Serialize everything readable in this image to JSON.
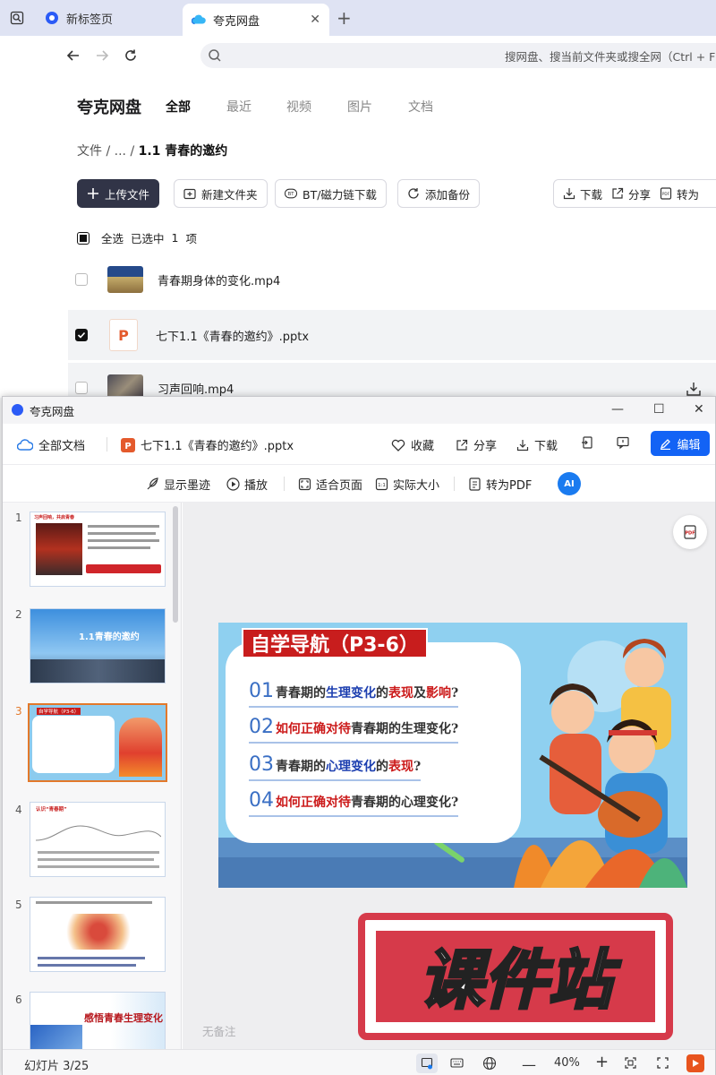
{
  "browser": {
    "tabs": [
      {
        "label": "新标签页",
        "active": false
      },
      {
        "label": "夸克网盘",
        "active": true
      }
    ],
    "address_placeholder": "搜网盘、搜当前文件夹或搜全网（Ctrl + F"
  },
  "drive": {
    "brand": "夸克网盘",
    "nav_tabs": [
      "全部",
      "最近",
      "视频",
      "图片",
      "文档"
    ],
    "breadcrumb": {
      "root": "文件",
      "sep1": "/",
      "ellipsis": "...",
      "sep2": "/",
      "current": "1.1 青春的邀约"
    },
    "actions": {
      "upload": "上传文件",
      "new_folder": "新建文件夹",
      "bt": "BT/磁力链下载",
      "backup": "添加备份",
      "download": "下载",
      "share": "分享",
      "convert": "转为"
    },
    "selection": {
      "select_all": "全选",
      "selected_prefix": "已选中",
      "selected_count": "1",
      "selected_suffix": "项"
    },
    "files": [
      {
        "name": "青春期身体的变化.mp4",
        "checked": false
      },
      {
        "name": "七下1.1《青春的邀约》.pptx",
        "checked": true
      },
      {
        "name": "习声回响.mp4",
        "checked": false
      }
    ]
  },
  "viewer": {
    "window_title": "夸克网盘",
    "breadcrumb_all": "全部文档",
    "file_name": "七下1.1《青春的邀约》.pptx",
    "toolbar": {
      "favorite": "收藏",
      "share": "分享",
      "download": "下载",
      "edit": "编辑"
    },
    "toolbar2": {
      "ink": "显示墨迹",
      "play": "播放",
      "fit_page": "适合页面",
      "actual_size": "实际大小",
      "to_pdf": "转为PDF",
      "ai": "AI"
    },
    "thumbnails": [
      {
        "num": "1",
        "caption": "习声回响，共启青春"
      },
      {
        "num": "2",
        "caption": "1.1青春的邀约"
      },
      {
        "num": "3",
        "caption": "自学导航（P3-6）"
      },
      {
        "num": "4",
        "caption": "认识“青春期”"
      },
      {
        "num": "5",
        "caption": ""
      },
      {
        "num": "6",
        "caption": "感悟青春生理变化"
      }
    ],
    "slide": {
      "title": "自学导航（P3-6）",
      "questions": [
        {
          "num": "01",
          "parts": [
            "青春期的",
            "生理变化",
            "的",
            "表现",
            "及",
            "影响",
            "?"
          ]
        },
        {
          "num": "02",
          "parts": [
            "如何正确对待",
            "青春期的生理变化?"
          ]
        },
        {
          "num": "03",
          "parts": [
            "青春期的",
            "心理变化",
            "的",
            "表现",
            "?"
          ]
        },
        {
          "num": "04",
          "parts": [
            "如何正确对待",
            "青春期的心理变化?"
          ]
        }
      ]
    },
    "watermark": "课件站",
    "notes_placeholder": "无备注",
    "status": {
      "slide_counter": "幻灯片 3/25",
      "zoom": "40%"
    }
  },
  "colors": {
    "accent_blue": "#1363f5",
    "selected_orange": "#e3792b",
    "title_red": "#c81d1d",
    "stamp_red": "#d63a4a"
  }
}
